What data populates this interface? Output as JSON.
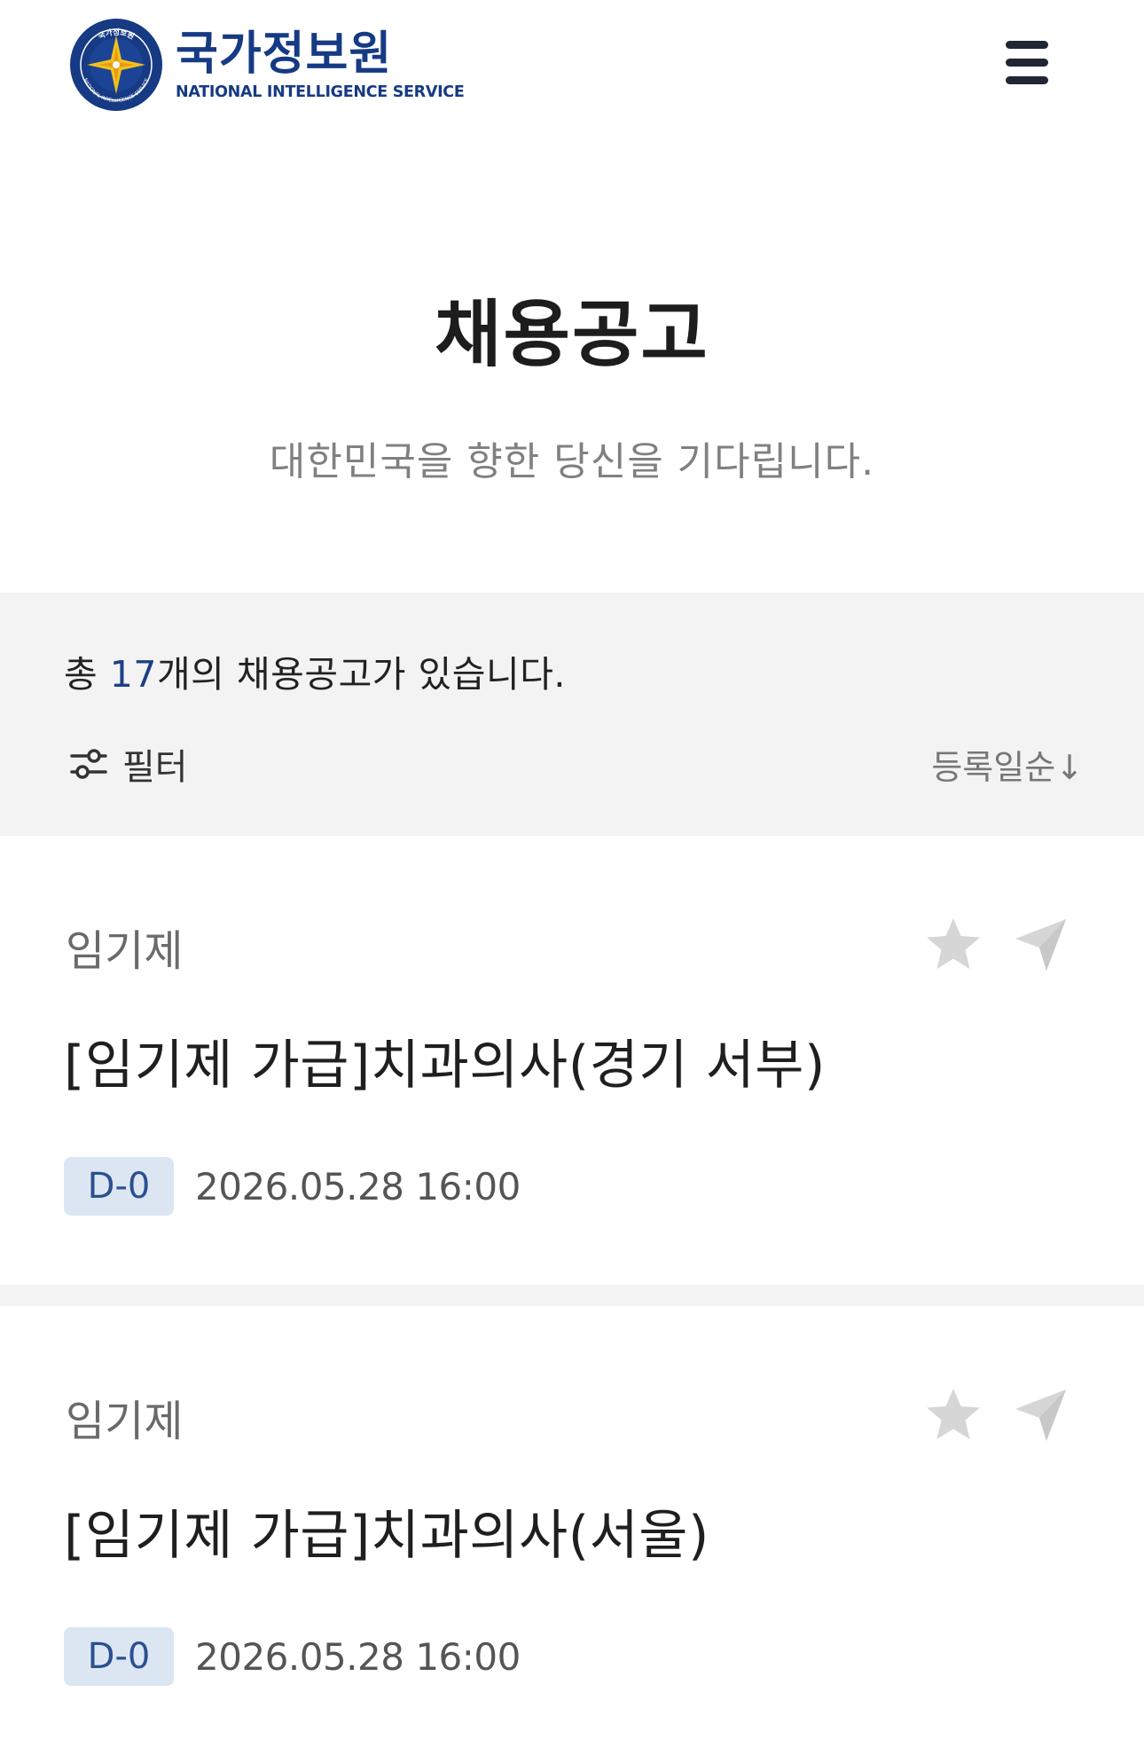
{
  "header": {
    "org_name_ko": "국가정보원",
    "org_name_en": "NATIONAL INTELLIGENCE SERVICE",
    "emblem_text": "국가정보원",
    "emblem_ring_text": "NATIONAL INTELLIGENCE SERVICE",
    "menu_icon": "hamburger-menu-icon"
  },
  "page": {
    "title": "채용공고",
    "subtitle": "대한민국을 향한 당신을 기다립니다."
  },
  "summary": {
    "prefix": "총 ",
    "count": "17",
    "suffix": "개의 채용공고가 있습니다.",
    "filter_label": "필터",
    "filter_icon": "sliders-icon",
    "sort_label": "등록일순↓"
  },
  "jobs": [
    {
      "type": "임기제",
      "title": "[임기제 가급]치과의사(경기 서부)",
      "dday": "D-0",
      "deadline": "2026.05.28 16:00"
    },
    {
      "type": "임기제",
      "title": "[임기제 가급]치과의사(서울)",
      "dday": "D-0",
      "deadline": "2026.05.28 16:00"
    }
  ],
  "colors": {
    "brand": "#163a84",
    "band_bg": "#f3f3f3",
    "badge_bg": "#dce6f2",
    "badge_text": "#2b4f91",
    "icon_gray": "#d6d6d6"
  }
}
